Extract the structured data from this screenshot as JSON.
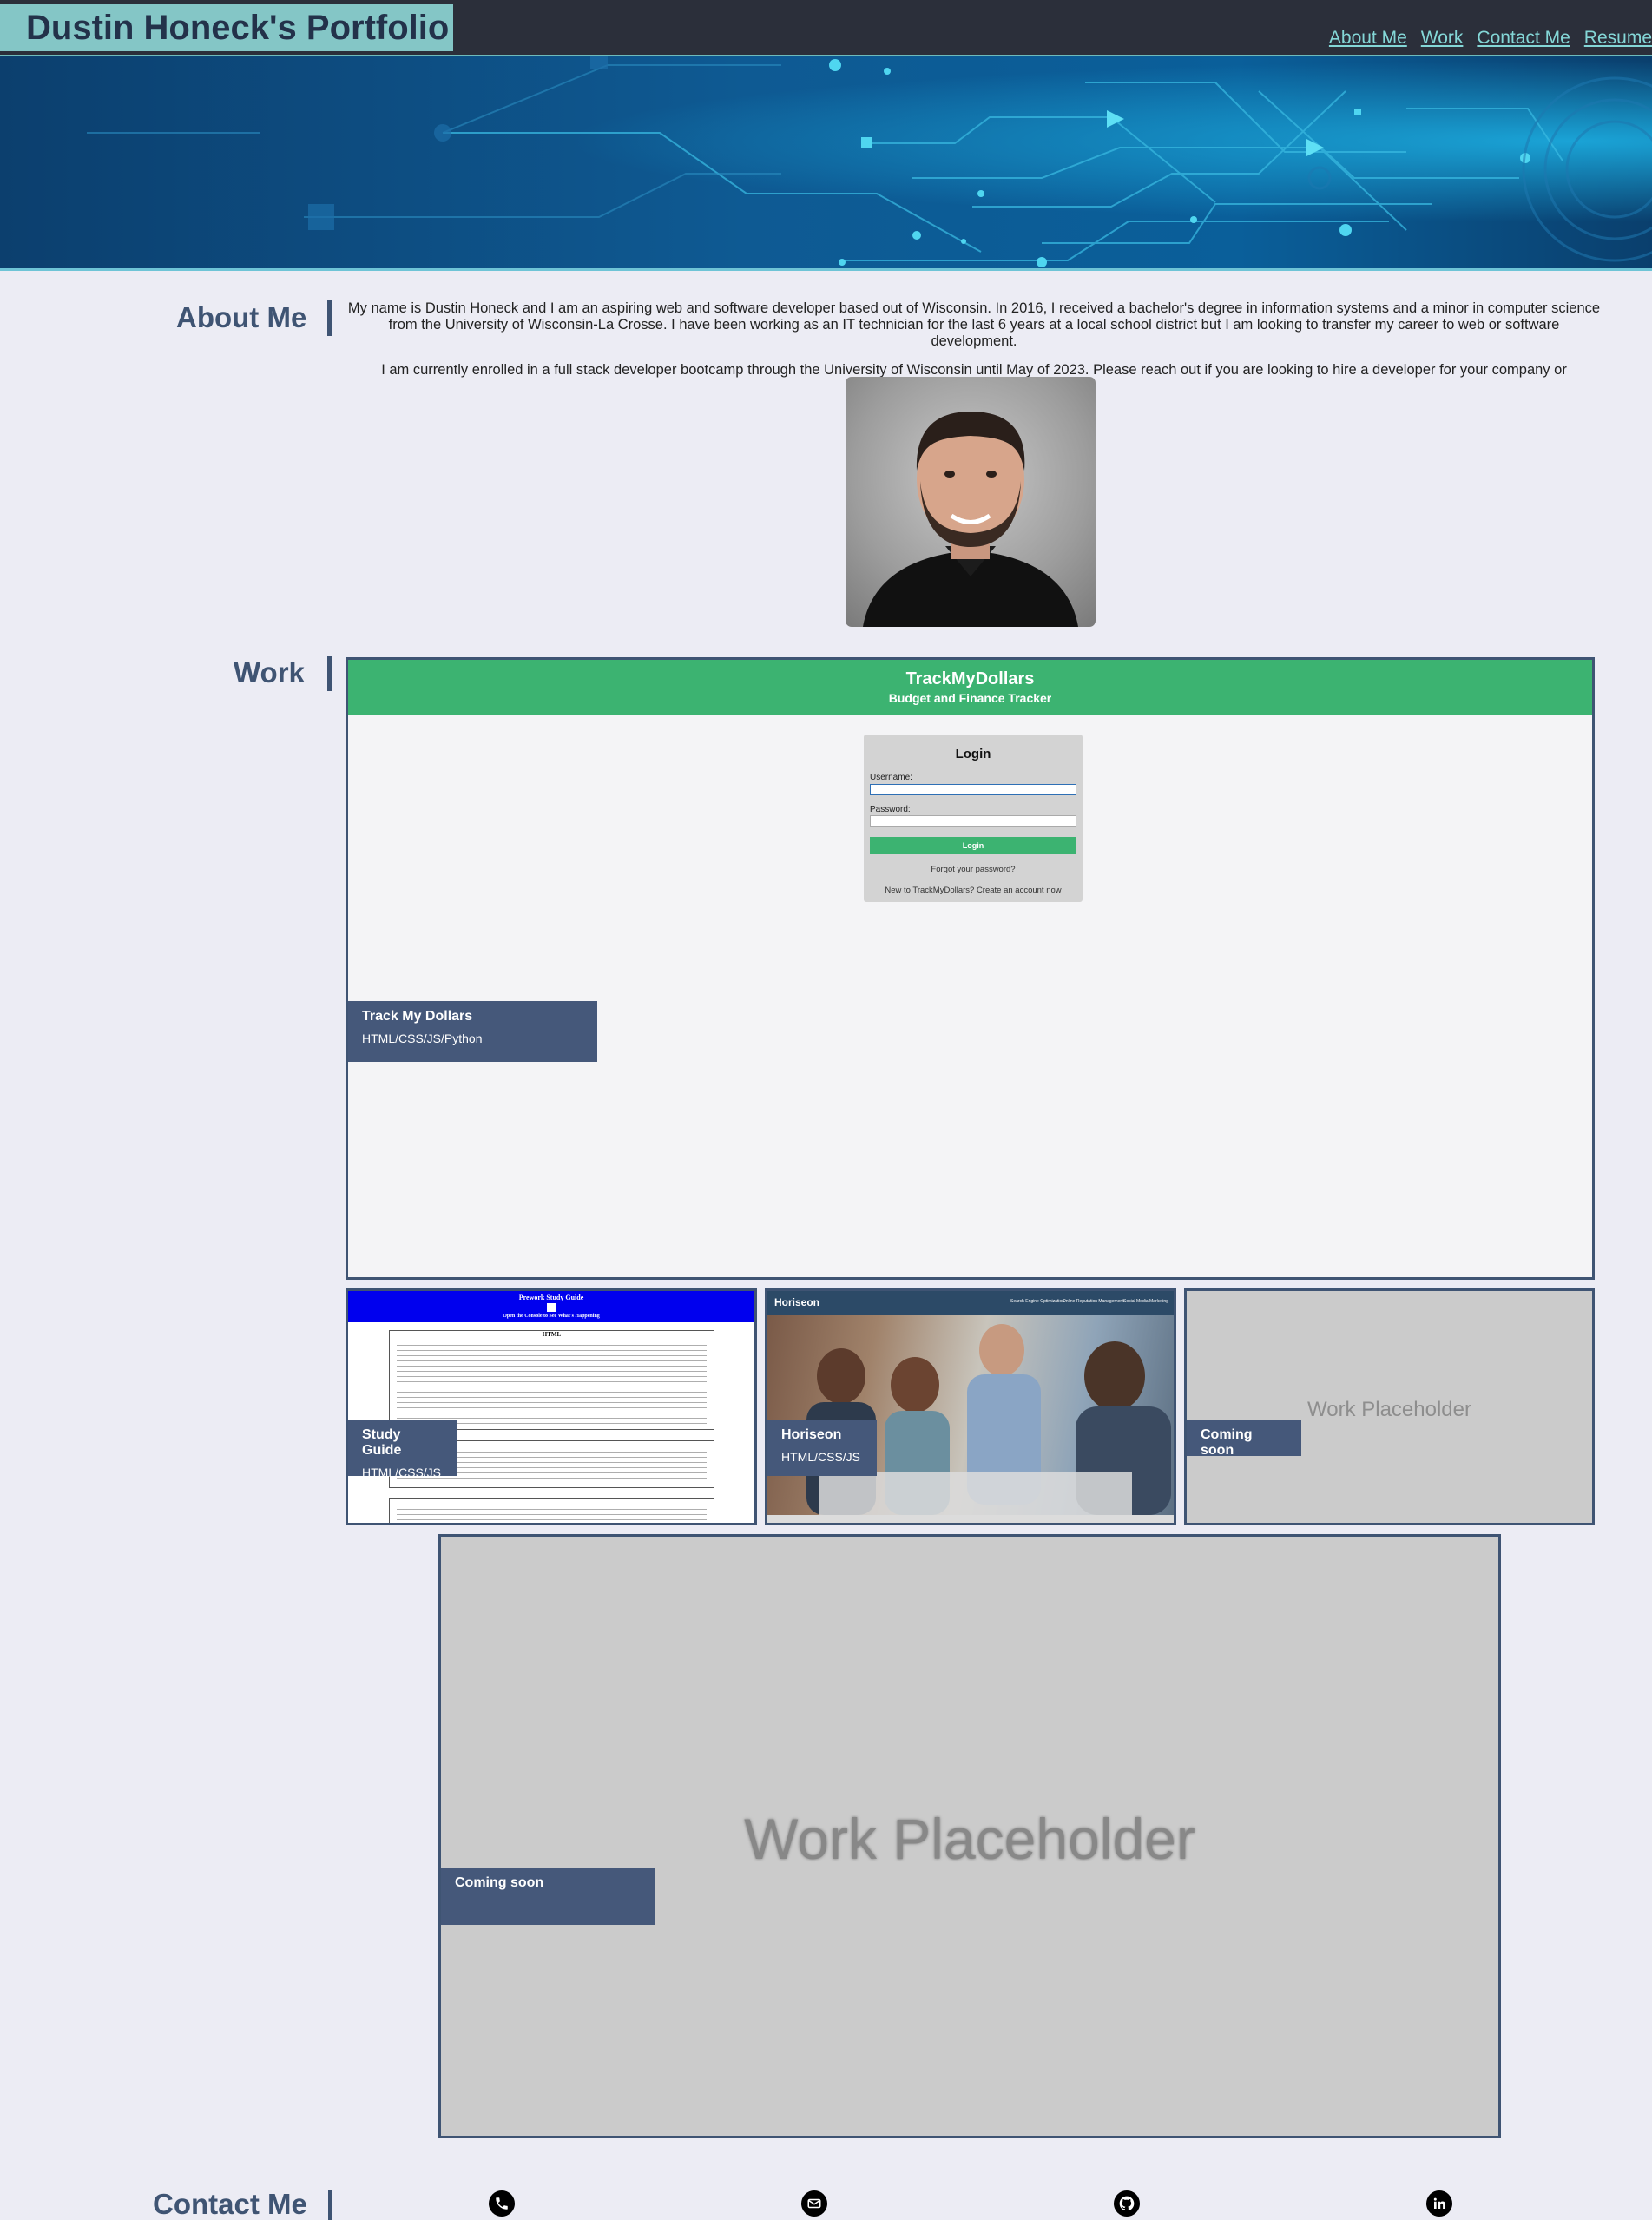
{
  "header": {
    "brand": "Dustin Honeck's Portfolio",
    "nav": [
      "About Me",
      "Work",
      "Contact Me",
      "Resume"
    ]
  },
  "about": {
    "title": "About Me",
    "paragraphs": [
      "My name is Dustin Honeck and I am an aspiring web and software developer based out of Wisconsin. In 2016, I received a bachelor's degree in information systems and a minor in computer science from the University of Wisconsin-La Crosse. I have been working as an IT technician for the last 6 years at a local school district but I am looking to transfer my career to web or software development.",
      "I am currently enrolled in a full stack developer bootcamp through the University of Wisconsin until May of 2023. Please reach out if you are looking to hire a developer for your company or organization."
    ]
  },
  "work": {
    "title": "Work",
    "featured": {
      "caption_title": "Track My Dollars",
      "caption_tech": "HTML/CSS/JS/Python",
      "preview": {
        "app_title": "TrackMyDollars",
        "app_subtitle": "Budget and Finance Tracker",
        "login_title": "Login",
        "username_label": "Username:",
        "password_label": "Password:",
        "login_button": "Login",
        "forgot": "Forgot your password?",
        "new_account": "New to TrackMyDollars? Create an account now"
      }
    },
    "cards": [
      {
        "caption_title": "Study Guide",
        "caption_tech": "HTML/CSS/JS",
        "preview_title": "Prework Study Guide",
        "preview_sub": "Open the Console to See What's Happening",
        "preview_section": "HTML"
      },
      {
        "caption_title": "Horiseon",
        "caption_tech": "HTML/CSS/JS",
        "preview_brand": "Horiseon",
        "preview_nav": [
          "Search Engine Optimization",
          "Online Reputation Management",
          "Social Media Marketing"
        ]
      },
      {
        "caption_title": "Coming soon",
        "placeholder": "Work Placeholder"
      }
    ],
    "large": {
      "caption_title": "Coming soon",
      "placeholder": "Work Placeholder"
    }
  },
  "contact": {
    "title": "Contact Me",
    "icons": [
      "phone-icon",
      "email-icon",
      "github-icon",
      "linkedin-icon"
    ]
  },
  "colors": {
    "header_bg": "#2b2f3a",
    "brand_bg": "#84c6c6",
    "nav_link": "#84d7d7",
    "heading": "#3f5473",
    "page_bg": "#ececf4",
    "caption_bg": "#45587a",
    "tmd_green": "#3cb371"
  }
}
